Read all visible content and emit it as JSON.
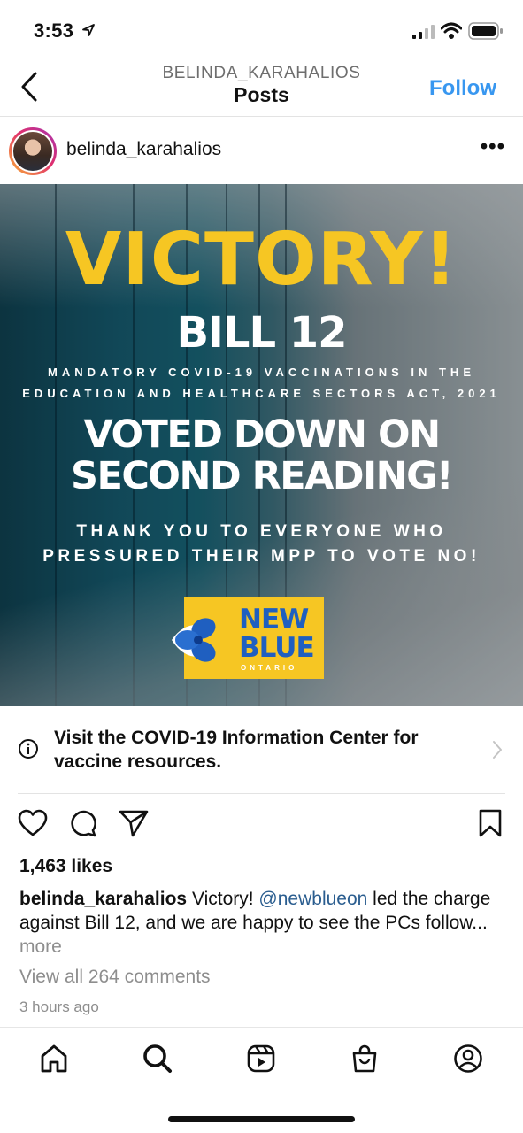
{
  "status_bar": {
    "time": "3:53"
  },
  "header": {
    "username": "BELINDA_KARAHALIOS",
    "title": "Posts",
    "follow_label": "Follow",
    "accent_color": "#3897f0"
  },
  "post": {
    "username": "belinda_karahalios",
    "image": {
      "headline": "VICTORY!",
      "bill": "BILL 12",
      "act_line_1": "MANDATORY COVID-19 VACCINATIONS IN THE",
      "act_line_2": "EDUCATION AND HEALTHCARE SECTORS ACT, 2021",
      "voted_line_1": "VOTED DOWN ON",
      "voted_line_2": "SECOND READING!",
      "thanks_line_1": "THANK YOU TO EVERYONE WHO",
      "thanks_line_2": "PRESSURED THEIR MPP TO VOTE NO!",
      "logo_line_1": "NEW",
      "logo_line_2": "BLUE",
      "logo_line_3": "ONTARIO",
      "headline_color": "#f6c623",
      "logo_color": "#1f5fc0"
    },
    "info_banner": "Visit the COVID-19 Information Center for vaccine resources.",
    "likes": "1,463 likes",
    "caption": {
      "username": "belinda_karahalios",
      "text_before": "Victory!",
      "mention": "@newblueon",
      "text_after": "led the charge against Bill 12, and we are happy to see the PCs follow...",
      "more_label": "more"
    },
    "view_comments": "View all 264 comments",
    "timestamp": "3 hours ago"
  },
  "icons": {
    "status": [
      "location-arrow-icon",
      "signal-icon",
      "wifi-icon",
      "battery-icon"
    ],
    "header": [
      "back-icon"
    ],
    "post": [
      "more-options-icon",
      "heart-icon",
      "comment-icon",
      "share-icon",
      "bookmark-icon",
      "info-icon",
      "chevron-right-icon"
    ],
    "tabbar": [
      "home-icon",
      "search-icon",
      "reels-icon",
      "shop-icon",
      "profile-icon"
    ]
  }
}
